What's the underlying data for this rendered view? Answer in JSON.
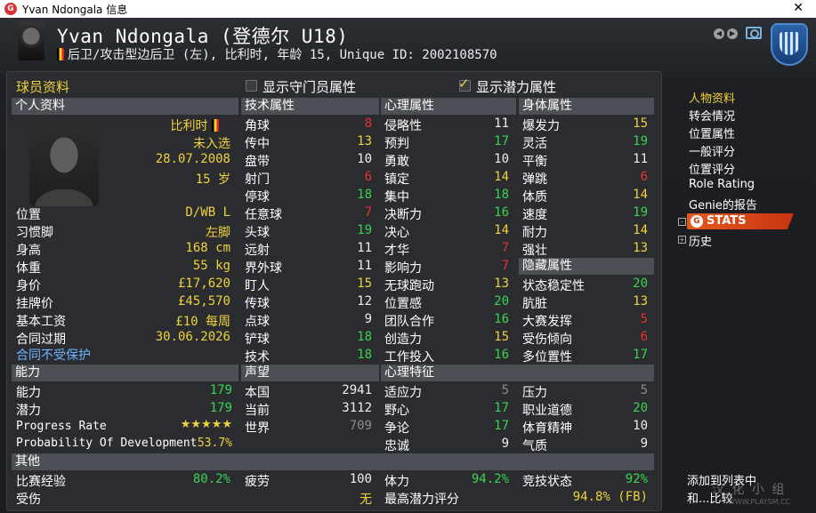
{
  "window": {
    "title": "Yvan Ndongala 信息"
  },
  "header": {
    "name": "Yvan Ndongala (登德尔 U18)",
    "subtitle": "后卫/攻击型边后卫 (左), 比利时, 年龄 15, Unique ID: 2002108570"
  },
  "topbar": {
    "section_title": "球员资料",
    "gk_label": "显示守门员属性",
    "potential_label": "显示潜力属性"
  },
  "personal": {
    "header": "个人资料",
    "nationality": "比利时",
    "selection": "未入选",
    "dob": "28.07.2008",
    "age": "15 岁",
    "rows": [
      {
        "label": "位置",
        "value": "D/WB L"
      },
      {
        "label": "习惯脚",
        "value": "左脚"
      },
      {
        "label": "身高",
        "value": "168 cm"
      },
      {
        "label": "体重",
        "value": "55 kg"
      },
      {
        "label": "身价",
        "value": "£17,620"
      },
      {
        "label": "挂牌价",
        "value": "£45,570"
      },
      {
        "label": "基本工资",
        "value": "£10 每周"
      },
      {
        "label": "合同过期",
        "value": "30.06.2026"
      }
    ],
    "contract_note": "合同不受保护"
  },
  "ability": {
    "header": "能力",
    "ability_label": "能力",
    "ability_value": "179",
    "potential_label": "潜力",
    "potential_value": "179",
    "progress_label": "Progress Rate",
    "progress_stars": "★★★★★",
    "prob_label": "Probability Of Development",
    "prob_value": "53.7%"
  },
  "technical": {
    "header": "技术属性",
    "rows": [
      {
        "label": "角球",
        "value": "8"
      },
      {
        "label": "传中",
        "value": "13"
      },
      {
        "label": "盘带",
        "value": "10"
      },
      {
        "label": "射门",
        "value": "6"
      },
      {
        "label": "停球",
        "value": "18"
      },
      {
        "label": "任意球",
        "value": "7"
      },
      {
        "label": "头球",
        "value": "19"
      },
      {
        "label": "远射",
        "value": "11"
      },
      {
        "label": "界外球",
        "value": "11"
      },
      {
        "label": "盯人",
        "value": "15"
      },
      {
        "label": "传球",
        "value": "12"
      },
      {
        "label": "点球",
        "value": "9"
      },
      {
        "label": "铲球",
        "value": "18"
      },
      {
        "label": "技术",
        "value": "18"
      }
    ]
  },
  "mental": {
    "header": "心理属性",
    "rows": [
      {
        "label": "侵略性",
        "value": "11"
      },
      {
        "label": "预判",
        "value": "17"
      },
      {
        "label": "勇敢",
        "value": "10"
      },
      {
        "label": "镇定",
        "value": "14"
      },
      {
        "label": "集中",
        "value": "18"
      },
      {
        "label": "决断力",
        "value": "16"
      },
      {
        "label": "决心",
        "value": "14"
      },
      {
        "label": "才华",
        "value": "7"
      },
      {
        "label": "影响力",
        "value": "7"
      },
      {
        "label": "无球跑动",
        "value": "13"
      },
      {
        "label": "位置感",
        "value": "20"
      },
      {
        "label": "团队合作",
        "value": "16"
      },
      {
        "label": "创造力",
        "value": "15"
      },
      {
        "label": "工作投入",
        "value": "16"
      }
    ]
  },
  "physical": {
    "header": "身体属性",
    "rows": [
      {
        "label": "爆发力",
        "value": "15"
      },
      {
        "label": "灵活",
        "value": "19"
      },
      {
        "label": "平衡",
        "value": "11"
      },
      {
        "label": "弹跳",
        "value": "6"
      },
      {
        "label": "体质",
        "value": "14"
      },
      {
        "label": "速度",
        "value": "19"
      },
      {
        "label": "耐力",
        "value": "14"
      },
      {
        "label": "强壮",
        "value": "13"
      }
    ]
  },
  "hidden": {
    "header": "隐藏属性",
    "rows": [
      {
        "label": "状态稳定性",
        "value": "20"
      },
      {
        "label": "肮脏",
        "value": "13"
      },
      {
        "label": "大赛发挥",
        "value": "5"
      },
      {
        "label": "受伤倾向",
        "value": "6"
      },
      {
        "label": "多位置性",
        "value": "17"
      }
    ]
  },
  "reputation": {
    "header": "声望",
    "rows": [
      {
        "label": "本国",
        "value": "2941"
      },
      {
        "label": "当前",
        "value": "3112"
      },
      {
        "label": "世界",
        "value": "709"
      }
    ]
  },
  "traits": {
    "header": "心理特征",
    "left": [
      {
        "label": "适应力",
        "value": "5"
      },
      {
        "label": "野心",
        "value": "17"
      },
      {
        "label": "争论",
        "value": "17"
      },
      {
        "label": "忠诚",
        "value": "9"
      }
    ],
    "right": [
      {
        "label": "压力",
        "value": "5"
      },
      {
        "label": "职业道德",
        "value": "20"
      },
      {
        "label": "体育精神",
        "value": "10"
      },
      {
        "label": "气质",
        "value": "9"
      }
    ]
  },
  "other": {
    "header": "其他",
    "match_exp_label": "比赛经验",
    "match_exp_value": "80.2%",
    "fatigue_label": "疲劳",
    "fatigue_value": "100",
    "stamina_label": "体力",
    "stamina_value": "94.2%",
    "condition_label": "竞技状态",
    "condition_value": "92%",
    "injury_label": "受伤",
    "injury_value": "无",
    "max_pot_label": "最高潜力评分",
    "max_pot_value": "94.8% (FB)"
  },
  "side_menu": {
    "items": [
      "人物资料",
      "转会情况",
      "位置属性",
      "一般评分",
      "位置评分",
      "Role Rating",
      "Genie的报告"
    ],
    "stats": "STATS",
    "history": "历史"
  },
  "actions": {
    "add_to_list": "添加到列表中",
    "compare": "和...比较"
  },
  "watermark": {
    "text": "汉 化 小 组",
    "sub": "WWW.PLAYSM.CC"
  }
}
